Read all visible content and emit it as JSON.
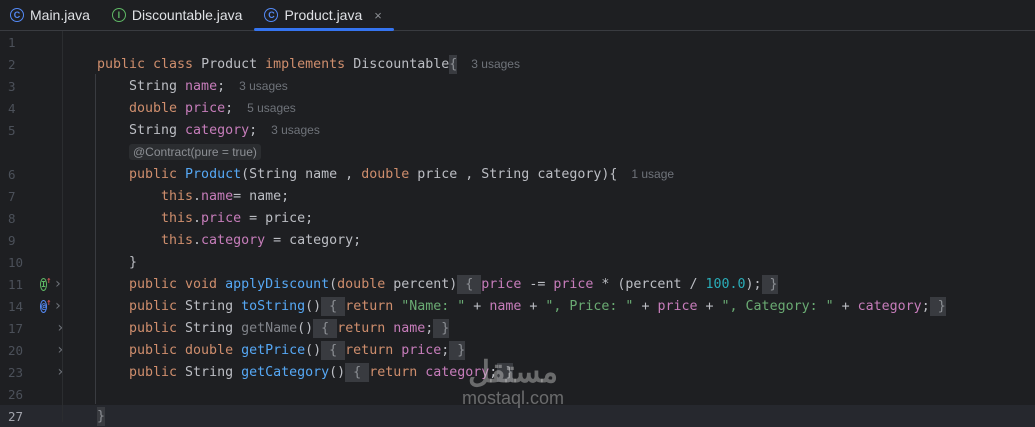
{
  "tabs": [
    {
      "label": "Main.java",
      "icon": "class-icon",
      "type": "C",
      "active": false
    },
    {
      "label": "Discountable.java",
      "icon": "interface-icon",
      "type": "I",
      "active": false
    },
    {
      "label": "Product.java",
      "icon": "class-icon",
      "type": "C",
      "active": true,
      "close": "×"
    }
  ],
  "lines": [
    {
      "num": "1",
      "indent": 0,
      "tokens": []
    },
    {
      "num": "2",
      "indent": 0,
      "tokens": [
        [
          "public class ",
          "kw"
        ],
        [
          "Product ",
          "tx"
        ],
        [
          "implements ",
          "kw"
        ],
        [
          "Discountable",
          "tx"
        ],
        [
          "{",
          "fold"
        ]
      ],
      "hint": "3 usages"
    },
    {
      "num": "3",
      "indent": 1,
      "tokens": [
        [
          "String ",
          "tx"
        ],
        [
          "name",
          "fd"
        ],
        [
          ";",
          "tx"
        ]
      ],
      "hint": "3 usages"
    },
    {
      "num": "4",
      "indent": 1,
      "tokens": [
        [
          "double ",
          "kw"
        ],
        [
          "price",
          "fd"
        ],
        [
          ";",
          "tx"
        ]
      ],
      "hint": "5 usages"
    },
    {
      "num": "5",
      "indent": 1,
      "tokens": [
        [
          "String ",
          "tx"
        ],
        [
          "category",
          "fd"
        ],
        [
          ";",
          "tx"
        ]
      ],
      "hint": "3 usages"
    },
    {
      "num": "",
      "indent": 1,
      "annotation": "@Contract(pure = true)",
      "tokens": []
    },
    {
      "num": "6",
      "indent": 1,
      "tokens": [
        [
          "public ",
          "kw"
        ],
        [
          "Product",
          "fn"
        ],
        [
          "(String name , ",
          "tx"
        ],
        [
          "double ",
          "kw"
        ],
        [
          "price , String category){",
          "tx"
        ]
      ],
      "hint": "1 usage"
    },
    {
      "num": "7",
      "indent": 2,
      "tokens": [
        [
          "this",
          "kw"
        ],
        [
          ".",
          "tx"
        ],
        [
          "name",
          "fd"
        ],
        [
          "= name;",
          "tx"
        ]
      ]
    },
    {
      "num": "8",
      "indent": 2,
      "tokens": [
        [
          "this",
          "kw"
        ],
        [
          ".",
          "tx"
        ],
        [
          "price",
          "fd"
        ],
        [
          " = price;",
          "tx"
        ]
      ]
    },
    {
      "num": "9",
      "indent": 2,
      "tokens": [
        [
          "this",
          "kw"
        ],
        [
          ".",
          "tx"
        ],
        [
          "category",
          "fd"
        ],
        [
          " = category;",
          "tx"
        ]
      ]
    },
    {
      "num": "10",
      "indent": 1,
      "tokens": [
        [
          "}",
          "tx"
        ]
      ]
    },
    {
      "num": "11",
      "indent": 1,
      "gutter": "implements-icon",
      "tokens": [
        [
          "public void ",
          "kw"
        ],
        [
          "applyDiscount",
          "fn"
        ],
        [
          "(",
          "tx"
        ],
        [
          "double ",
          "kw"
        ],
        [
          "percent)",
          "tx"
        ],
        [
          " { ",
          "fold"
        ],
        [
          "price",
          "fd"
        ],
        [
          " -= ",
          "tx"
        ],
        [
          "price",
          "fd"
        ],
        [
          " * (percent / ",
          "tx"
        ],
        [
          "100.0",
          "nm"
        ],
        [
          ");",
          "tx"
        ],
        [
          " }",
          "fold"
        ]
      ]
    },
    {
      "num": "14",
      "indent": 1,
      "gutter": "overrides-icon",
      "tokens": [
        [
          "public ",
          "kw"
        ],
        [
          "String ",
          "tx"
        ],
        [
          "toString",
          "fn"
        ],
        [
          "()",
          "tx"
        ],
        [
          " { ",
          "fold"
        ],
        [
          "return ",
          "kw"
        ],
        [
          "\"Name: \"",
          "st"
        ],
        [
          " + ",
          "tx"
        ],
        [
          "name",
          "fd"
        ],
        [
          " + ",
          "tx"
        ],
        [
          "\", Price: \"",
          "st"
        ],
        [
          " + ",
          "tx"
        ],
        [
          "price",
          "fd"
        ],
        [
          " + ",
          "tx"
        ],
        [
          "\", Category: \"",
          "st"
        ],
        [
          " + ",
          "tx"
        ],
        [
          "category",
          "fd"
        ],
        [
          ";",
          "tx"
        ],
        [
          " }",
          "fold"
        ]
      ]
    },
    {
      "num": "17",
      "indent": 1,
      "gutter": "fold",
      "tokens": [
        [
          "public ",
          "kw"
        ],
        [
          "String ",
          "tx"
        ],
        [
          "getName",
          "gr"
        ],
        [
          "()",
          "tx"
        ],
        [
          " { ",
          "fold"
        ],
        [
          "return ",
          "kw"
        ],
        [
          "name",
          "fd"
        ],
        [
          ";",
          "tx"
        ],
        [
          " }",
          "fold"
        ]
      ]
    },
    {
      "num": "20",
      "indent": 1,
      "gutter": "fold",
      "tokens": [
        [
          "public double ",
          "kw"
        ],
        [
          "getPrice",
          "fn"
        ],
        [
          "()",
          "tx"
        ],
        [
          " { ",
          "fold"
        ],
        [
          "return ",
          "kw"
        ],
        [
          "price",
          "fd"
        ],
        [
          ";",
          "tx"
        ],
        [
          " }",
          "fold"
        ]
      ]
    },
    {
      "num": "23",
      "indent": 1,
      "gutter": "fold",
      "tokens": [
        [
          "public ",
          "kw"
        ],
        [
          "String ",
          "tx"
        ],
        [
          "getCategory",
          "fn"
        ],
        [
          "()",
          "tx"
        ],
        [
          " { ",
          "fold"
        ],
        [
          "return ",
          "kw"
        ],
        [
          "category",
          "fd"
        ],
        [
          ";",
          "tx"
        ],
        [
          " }",
          "fold"
        ]
      ]
    },
    {
      "num": "26",
      "indent": 0,
      "tokens": []
    },
    {
      "num": "27",
      "indent": 0,
      "current": true,
      "tokens": [
        [
          "}",
          "fold"
        ]
      ]
    }
  ],
  "watermark": {
    "arabic": "مستقل",
    "latin": "mostaql.com"
  }
}
